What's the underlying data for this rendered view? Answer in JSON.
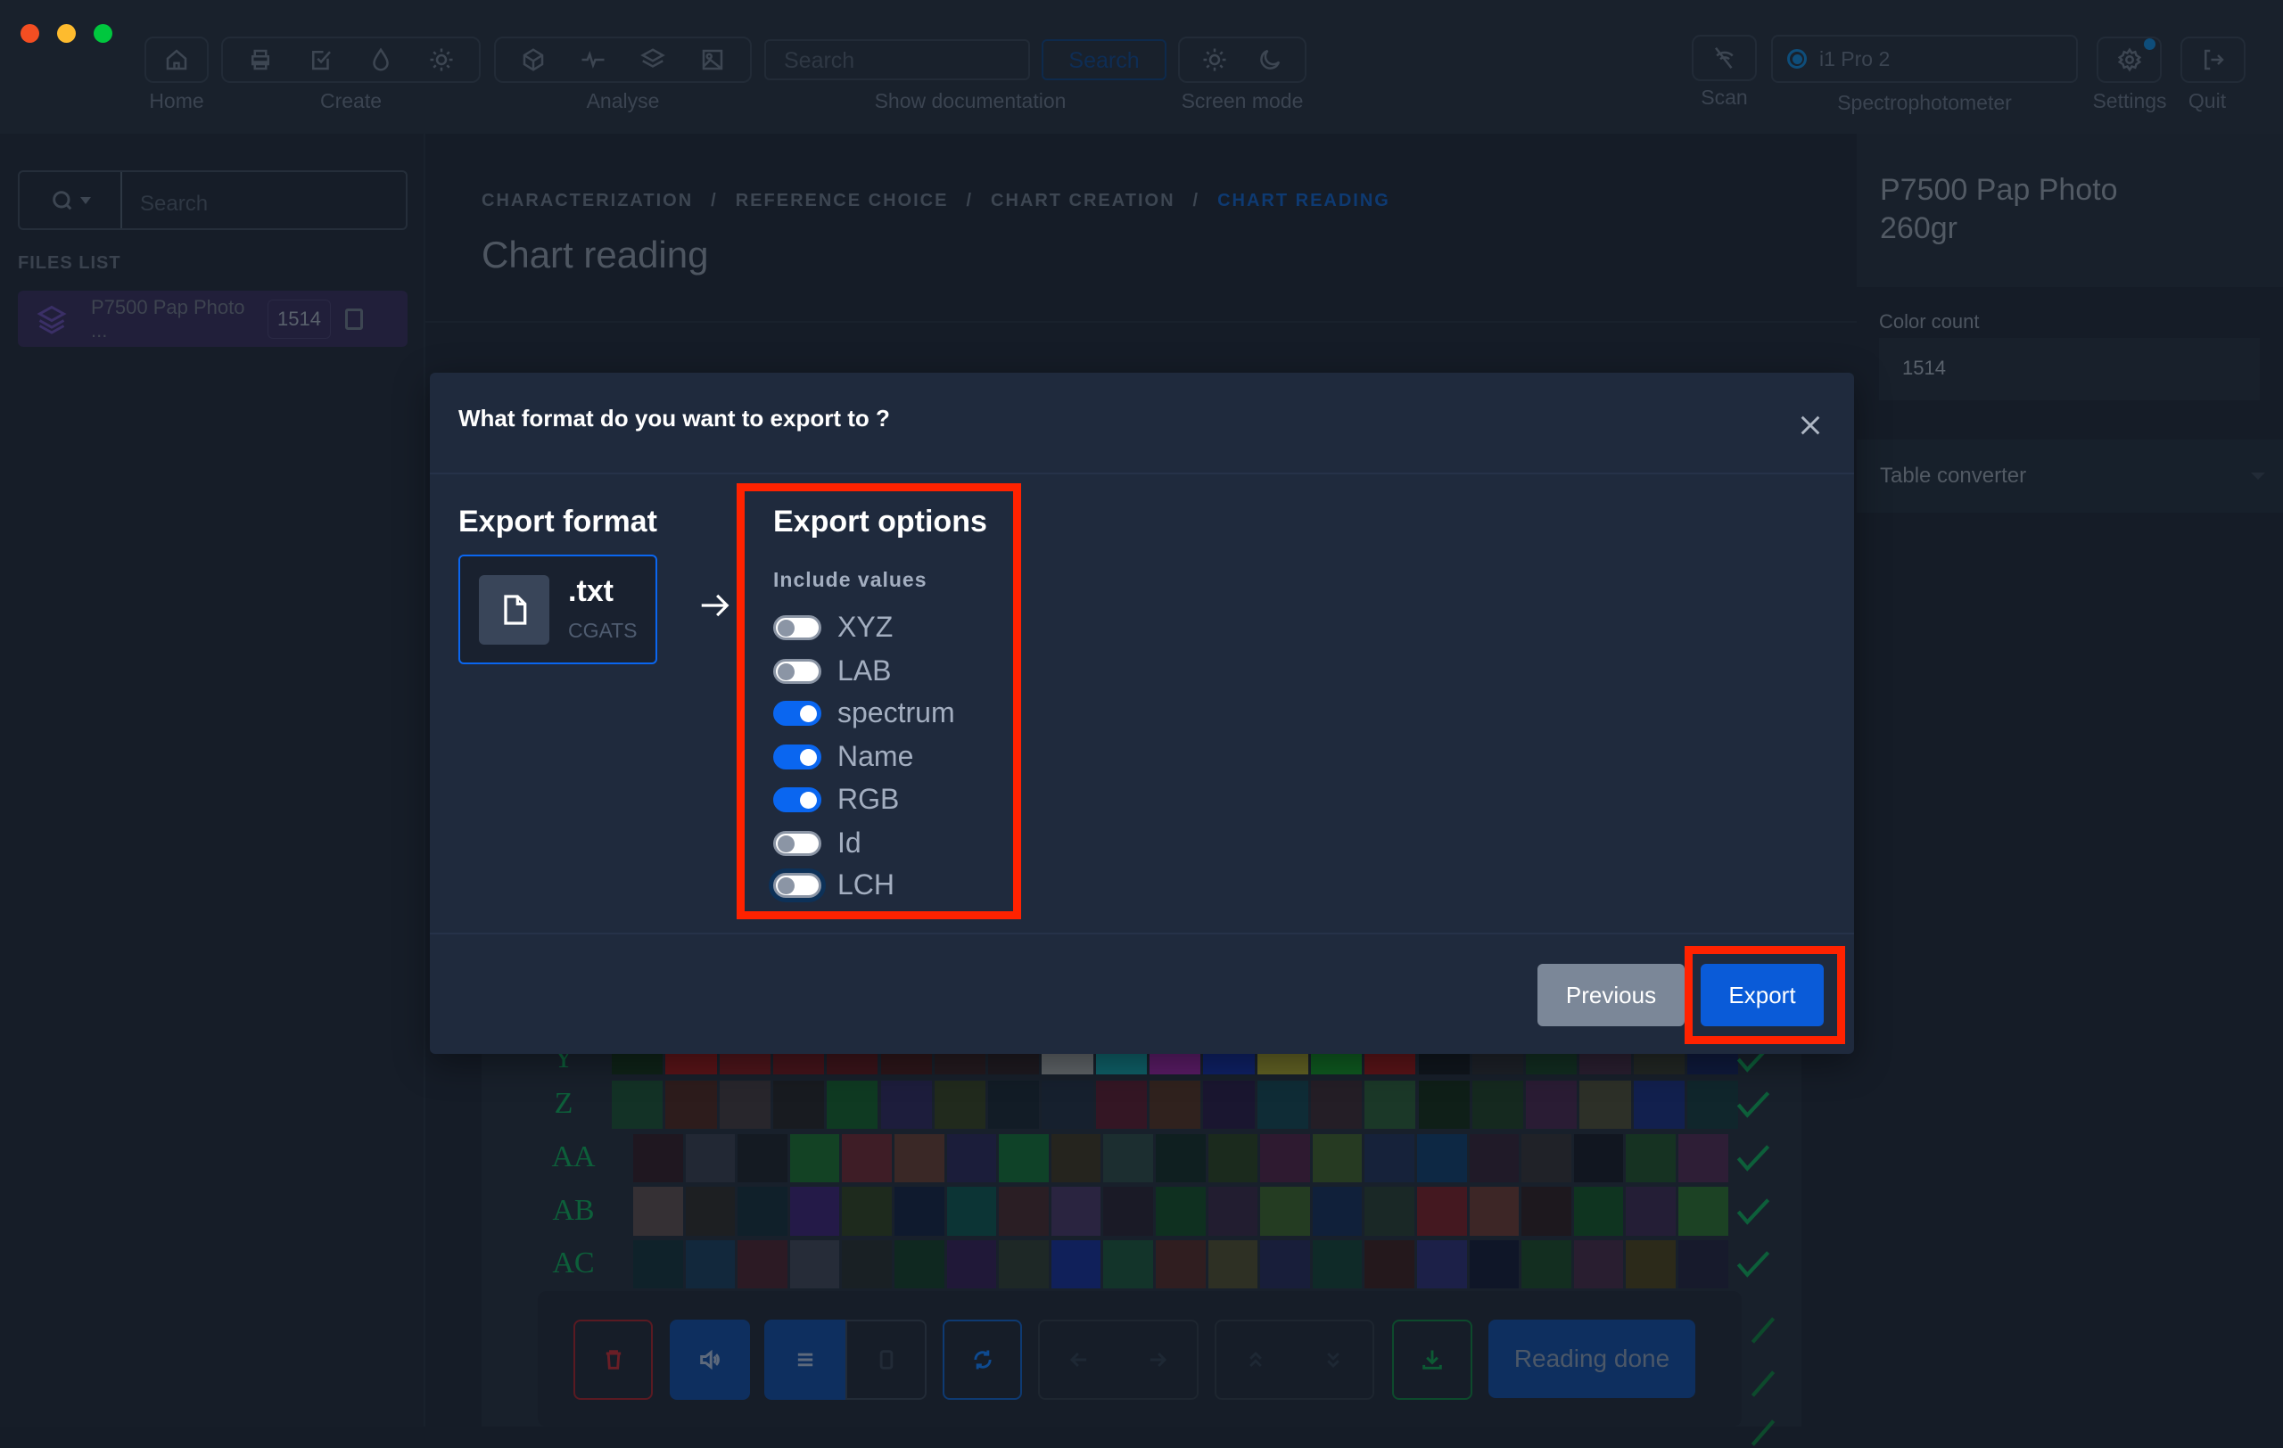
{
  "window": {
    "traffic_lights": [
      "#f44e22",
      "#febb2e",
      "#00c73e"
    ]
  },
  "toolbar": {
    "home_label": "Home",
    "create_label": "Create",
    "analyse_label": "Analyse",
    "search_placeholder": "Search",
    "search_button": "Search",
    "show_documentation_label": "Show documentation",
    "screen_mode_label": "Screen mode",
    "scan_label": "Scan",
    "spectrophotometer_value": "i1 Pro 2",
    "spectrophotometer_label": "Spectrophotometer",
    "settings_label": "Settings",
    "quit_label": "Quit"
  },
  "sidebar": {
    "search_placeholder": "Search",
    "files_list_heading": "FILES LIST",
    "files": [
      {
        "name": "P7500 Pap Photo ...",
        "count": "1514"
      }
    ]
  },
  "main": {
    "breadcrumb": [
      "CHARACTERIZATION",
      "REFERENCE CHOICE",
      "CHART CREATION",
      "CHART READING"
    ],
    "breadcrumb_separator": "/",
    "title": "Chart reading",
    "chart_rows": [
      {
        "label": "Y",
        "colors": [
          "#0f2318",
          "#5a1418",
          "#4e151b",
          "#45141b",
          "#3b141a",
          "#2d161a",
          "#241a1f",
          "#1e1a20",
          "#5f6468",
          "#0f6068",
          "#5a1c66",
          "#0f2166",
          "#626224",
          "#0f5a20",
          "#5a1418",
          "#10161d",
          "#1d2128",
          "#122d21",
          "#2a1f30",
          "#222724",
          "#0f1a3c"
        ]
      },
      {
        "label": "Z",
        "colors": [
          "#133226",
          "#2d1c1c",
          "#28262c",
          "#181b20",
          "#0f3a22",
          "#1d1d3c",
          "#212a1d",
          "#121c26",
          "#16202e",
          "#341624",
          "#30221e",
          "#1a1630",
          "#0f2c36",
          "#241e26",
          "#1b3828",
          "#0f1f18",
          "#15291f",
          "#2a1c34",
          "#2d3028",
          "#12204e",
          "#10262c"
        ]
      },
      {
        "label": "AA",
        "colors": [
          "#1f1720",
          "#222834",
          "#141a22",
          "#134224",
          "#3e1d26",
          "#3a2826",
          "#1b1d3a",
          "#0f4228",
          "#25241e",
          "#1c2e30",
          "#0f1f20",
          "#1b2a1d",
          "#2e1a30",
          "#263a22",
          "#16223a",
          "#0d2844",
          "#201a28",
          "#202228",
          "#111620",
          "#163222",
          "#2e1e36"
        ]
      },
      {
        "label": "AB",
        "colors": [
          "#353034",
          "#1d1f22",
          "#10202a",
          "#241a48",
          "#1e2a1d",
          "#0f1a2e",
          "#0c3435",
          "#2a1e24",
          "#2a2440",
          "#1a1a26",
          "#0f3020",
          "#221d30",
          "#243c22",
          "#10203a",
          "#1a2826",
          "#441820",
          "#3d2626",
          "#1d181e",
          "#0f3420",
          "#241e36",
          "#1c4224"
        ]
      },
      {
        "label": "AC",
        "colors": [
          "#0f222a",
          "#12283c",
          "#2c1a24",
          "#262c38",
          "#192024",
          "#0f2820",
          "#201838",
          "#1e2826",
          "#10205a",
          "#13342a",
          "#301e20",
          "#2e3024",
          "#181e3a",
          "#0f2a28",
          "#24181c",
          "#1c2048",
          "#0f1628",
          "#132e20",
          "#291e30",
          "#2c2a1a",
          "#171a2c"
        ]
      }
    ],
    "reading_done_button": "Reading done"
  },
  "right_panel": {
    "title": "P7500 Pap Photo 260gr",
    "color_count_label": "Color count",
    "color_count_value": "1514",
    "table_converter_label": "Table converter"
  },
  "modal": {
    "title": "What format do you want to export to ?",
    "export_format_heading": "Export format",
    "format": {
      "extension": ".txt",
      "type": "CGATS",
      "icon": "file-icon"
    },
    "export_options_heading": "Export options",
    "include_values_label": "Include values",
    "options": [
      {
        "label": "XYZ",
        "enabled": false
      },
      {
        "label": "LAB",
        "enabled": false
      },
      {
        "label": "spectrum",
        "enabled": true
      },
      {
        "label": "Name",
        "enabled": true
      },
      {
        "label": "RGB",
        "enabled": true
      },
      {
        "label": "Id",
        "enabled": false
      },
      {
        "label": "LCH",
        "enabled": false,
        "focused": true
      }
    ],
    "previous_button": "Previous",
    "export_button": "Export"
  },
  "colors": {
    "accent": "#0a66f0",
    "highlight": "#ff2200",
    "modal_bg": "#1f2a3d"
  }
}
